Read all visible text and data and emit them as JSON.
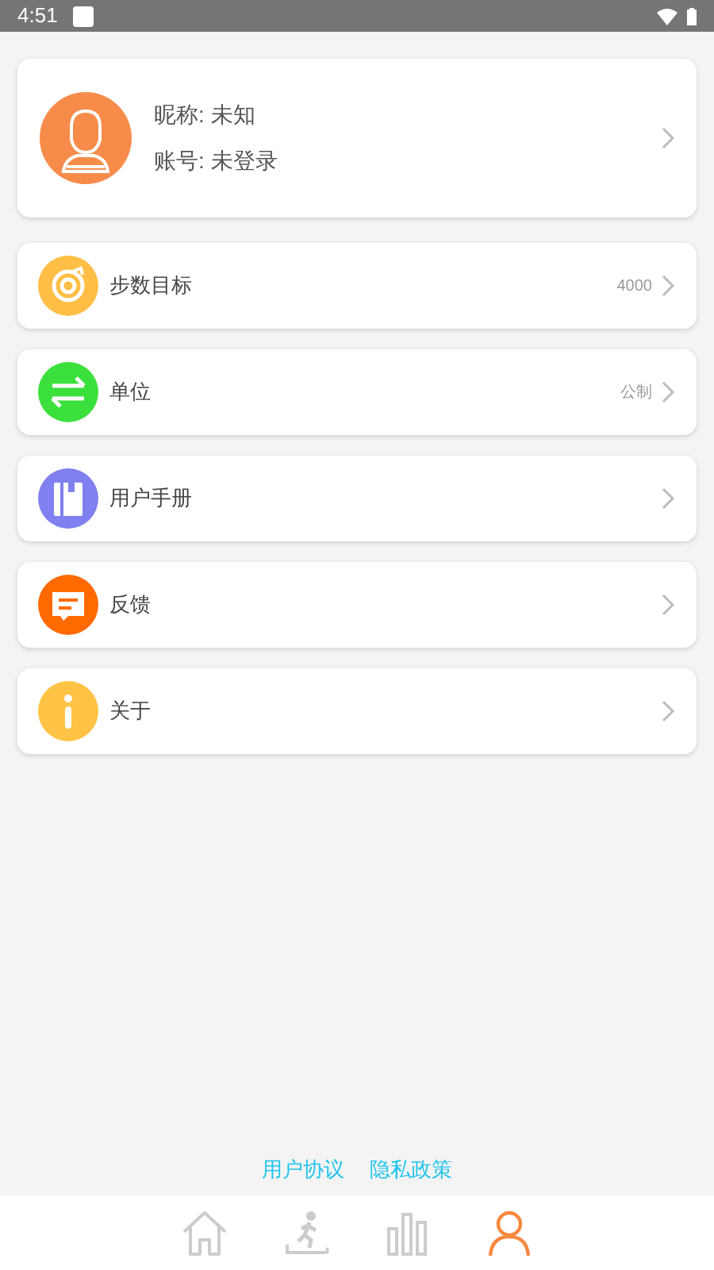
{
  "status_bar": {
    "time": "4:51"
  },
  "profile": {
    "nickname": "昵称: 未知",
    "account": "账号: 未登录"
  },
  "menu": [
    {
      "kind": "target",
      "label": "步数目标",
      "value": "4000",
      "color": "#ffbe46"
    },
    {
      "kind": "swap",
      "label": "单位",
      "value": "公制",
      "color": "#3ce03c"
    },
    {
      "kind": "book",
      "label": "用户手册",
      "color": "#8080f0"
    },
    {
      "kind": "chat",
      "label": "反馈",
      "color": "#ff6a00"
    },
    {
      "kind": "info",
      "label": "关于",
      "color": "#ffc446"
    }
  ],
  "links": [
    "用户协议",
    "隐私政策"
  ],
  "nav": [
    {
      "kind": "home",
      "selected": false
    },
    {
      "kind": "run",
      "selected": false
    },
    {
      "kind": "stats",
      "selected": false
    },
    {
      "kind": "person",
      "selected": true
    }
  ]
}
